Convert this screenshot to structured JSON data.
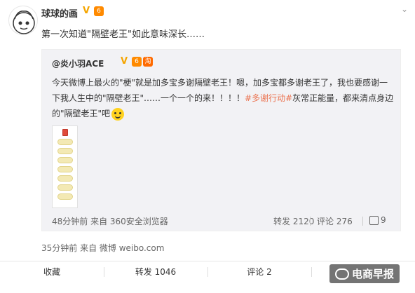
{
  "post": {
    "author": "球球的画",
    "badge_vip": "6",
    "text": "第一次知道\"隔壁老王\"如此意味深长……",
    "meta": "35分钟前 来自 微博 weibo.com"
  },
  "quoted": {
    "author": "@炎小羽ACE",
    "badge_tao": "淘",
    "lines": [
      "今天微博上最火的\"梗\"就是加多宝多谢隔壁老王！嗯，加多宝都多谢老王了，我也要感谢一",
      "下我人生中的\"隔壁老王\"……一个一个的来！！！！"
    ],
    "tag": "#多谢行动#",
    "line2_tail": "灰常正能量，都来清点身边",
    "line3": "的\"隔壁老王\"吧",
    "time_source": "48分钟前 来自 360安全浏览器",
    "repost": "转发 2120",
    "comment": "评论 276",
    "like": "9"
  },
  "actions": {
    "favorite": "收藏",
    "repost": "转发 1046",
    "comment": "评论 2"
  },
  "watermark": "电商早报",
  "icons": {
    "more": "chevron-down-icon",
    "like": "thumbs-up-icon",
    "verified": "verified-v-icon"
  },
  "colors": {
    "tag": "#eb7350",
    "verified": "#f5a500",
    "vip": "#ff8a00"
  }
}
